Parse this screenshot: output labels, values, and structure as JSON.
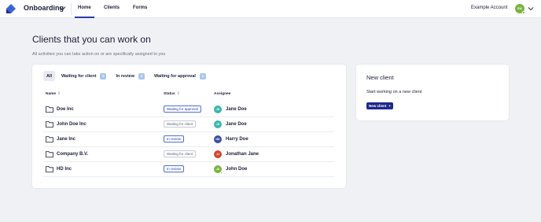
{
  "topbar": {
    "app_name": "Onboarding",
    "nav": [
      {
        "label": "Home",
        "active": true
      },
      {
        "label": "Clients",
        "active": false
      },
      {
        "label": "Forms",
        "active": false
      }
    ],
    "account_name": "Example Account",
    "account_initials": "EA",
    "icons": [
      "logo-icon",
      "chevron-down-icon",
      "avatar",
      "chevron-down-icon"
    ]
  },
  "page": {
    "title": "Clients that you can work on",
    "subtitle": "All activities you can take action on or are specifically assigned to you"
  },
  "filters": [
    {
      "label": "All",
      "count": null,
      "active": true
    },
    {
      "label": "Waiting for client",
      "count": "2",
      "active": false
    },
    {
      "label": "In review",
      "count": "2",
      "active": false
    },
    {
      "label": "Waiting for approval",
      "count": "1",
      "active": false
    }
  ],
  "table": {
    "headers": {
      "name": "Name",
      "status": "Status",
      "assignee": "Assignee"
    },
    "rows": [
      {
        "name": "Doe Inc",
        "status": "Waiting for approval",
        "status_style": "blue",
        "assignee": "Jane Doe",
        "initials": "JD",
        "avatar_color": "#3cb6ac",
        "online": false
      },
      {
        "name": "John Doe Inc",
        "status": "Waiting for client",
        "status_style": "grey",
        "assignee": "Jane Doe",
        "initials": "JD",
        "avatar_color": "#3cb6ac",
        "online": false
      },
      {
        "name": "Jane Inc",
        "status": "In review",
        "status_style": "blue",
        "assignee": "Harry Doe",
        "initials": "HD",
        "avatar_color": "#3c4ea6",
        "online": false
      },
      {
        "name": "Company B.V.",
        "status": "Waiting for client",
        "status_style": "grey",
        "assignee": "Jonathan Jane",
        "initials": "JJ",
        "avatar_color": "#d0472f",
        "online": false
      },
      {
        "name": "HD Inc",
        "status": "In review",
        "status_style": "blue",
        "assignee": "John Doe",
        "initials": "JD",
        "avatar_color": "#7bb440",
        "online": true
      }
    ]
  },
  "new_client": {
    "title": "New client",
    "text": "Start working on a new client",
    "button": "New client",
    "button_icon": "+"
  },
  "colors": {
    "accent": "#2d3aa6",
    "button": "#1e2a8c",
    "count_badge": "#a9c7ee",
    "background": "#f0f1f4"
  }
}
